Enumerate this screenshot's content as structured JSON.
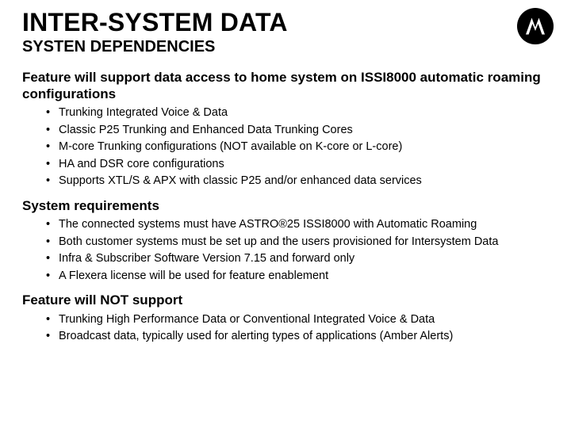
{
  "header": {
    "title": "INTER-SYSTEM DATA",
    "subtitle": "SYSTEN DEPENDENCIES"
  },
  "sections": [
    {
      "heading": "Feature will support data access to home system on ISSI8000 automatic roaming configurations",
      "items": [
        "Trunking Integrated Voice & Data",
        "Classic P25 Trunking and Enhanced Data Trunking Cores",
        "M-core Trunking configurations (NOT available on K-core or L-core)",
        "HA and DSR core configurations",
        "Supports XTL/S & APX with classic P25 and/or enhanced data services"
      ]
    },
    {
      "heading": "System requirements",
      "items": [
        "The connected systems must have ASTRO®25 ISSI8000 with Automatic Roaming",
        "Both customer systems must be set up and the users provisioned for Intersystem Data",
        "Infra & Subscriber Software Version 7.15 and forward only",
        "A Flexera license will be used for feature enablement"
      ]
    },
    {
      "heading": "Feature will NOT support",
      "items": [
        "Trunking High Performance Data or Conventional Integrated Voice & Data",
        "Broadcast data, typically used for alerting types of applications (Amber Alerts)"
      ]
    }
  ],
  "brand": {
    "name": "Motorola"
  }
}
